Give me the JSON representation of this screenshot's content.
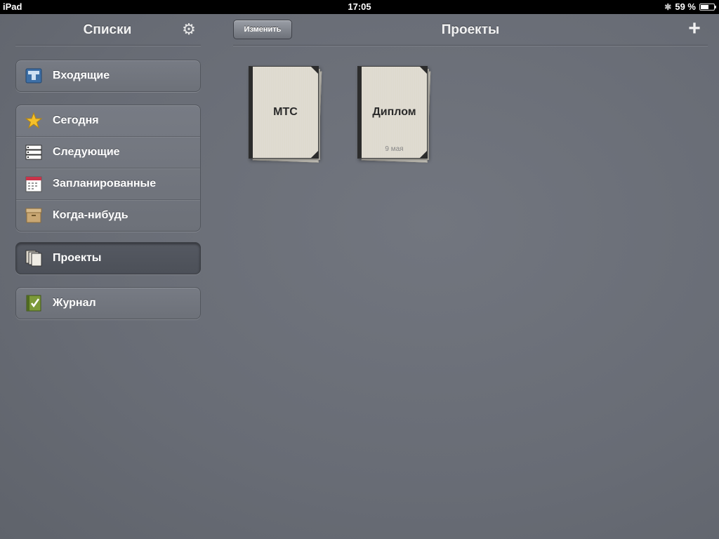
{
  "status_bar": {
    "device": "iPad",
    "time": "17:05",
    "battery": "59 %",
    "battery_level": 0.59
  },
  "left_panel": {
    "title": "Списки",
    "groups": [
      [
        {
          "label": "Входящие",
          "icon": "inbox-icon"
        }
      ],
      [
        {
          "label": "Сегодня",
          "icon": "star-icon"
        },
        {
          "label": "Следующие",
          "icon": "next-list-icon"
        },
        {
          "label": "Запланированные",
          "icon": "calendar-icon"
        },
        {
          "label": "Когда-нибудь",
          "icon": "archive-box-icon"
        }
      ],
      [
        {
          "label": "Проекты",
          "icon": "projects-icon",
          "selected": true
        }
      ],
      [
        {
          "label": "Журнал",
          "icon": "logbook-icon"
        }
      ]
    ]
  },
  "right_panel": {
    "edit_label": "Изменить",
    "title": "Проекты",
    "projects": [
      {
        "title": "МТС",
        "date": ""
      },
      {
        "title": "Диплом",
        "date": "9 мая"
      }
    ]
  }
}
